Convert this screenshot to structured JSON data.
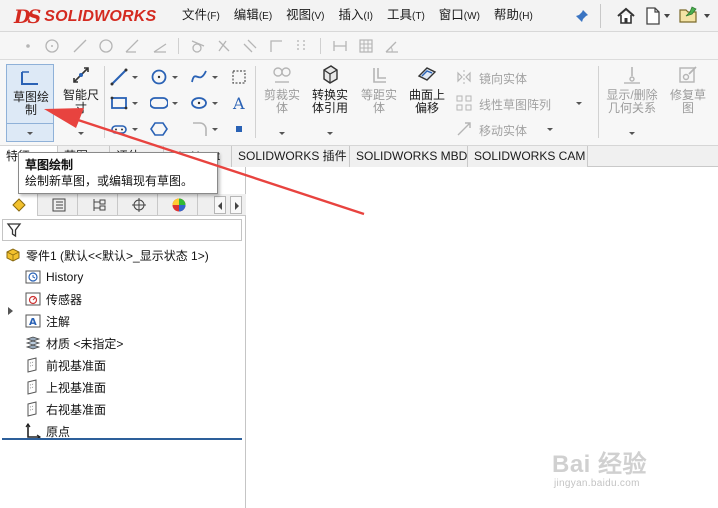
{
  "app": {
    "logo_ds": "DS",
    "logo_text": "SOLIDWORKS"
  },
  "menu": [
    {
      "label": "文件",
      "mnemonic": "(F)"
    },
    {
      "label": "编辑",
      "mnemonic": "(E)"
    },
    {
      "label": "视图",
      "mnemonic": "(V)"
    },
    {
      "label": "插入",
      "mnemonic": "(I)"
    },
    {
      "label": "工具",
      "mnemonic": "(T)"
    },
    {
      "label": "窗口",
      "mnemonic": "(W)"
    },
    {
      "label": "帮助",
      "mnemonic": "(H)"
    }
  ],
  "commands": {
    "sketch": "草图绘制",
    "smart_dimension": "智能尺寸",
    "trim_entities": "剪裁实体",
    "convert_entities": "转换实体引用",
    "offset_entities": "等距实体",
    "offset_on_surface": "曲面上偏移",
    "mirror_entities": "镜向实体",
    "linear_pattern": "线性草图阵列",
    "move_entities": "移动实体",
    "display_delete_relations": "显示/删除几何关系",
    "repair_sketch": "修复草图"
  },
  "tabs": [
    "特征",
    "草图",
    "评估",
    "DimXpert",
    "SOLIDWORKS 插件",
    "SOLIDWORKS MBD",
    "SOLIDWORKS CAM"
  ],
  "tooltip": {
    "title": "草图绘制",
    "description": "绘制新草图，或编辑现有草图。"
  },
  "tree": {
    "part": "零件1 (默认<<默认>_显示状态 1>)",
    "items": [
      "History",
      "传感器",
      "注解",
      "材质 <未指定>",
      "前视基准面",
      "上视基准面",
      "右视基准面",
      "原点"
    ]
  },
  "watermark": {
    "brand": "Bai 经验",
    "url": "jingyan.baidu.com"
  },
  "colors": {
    "brand_red": "#d42a20",
    "annotation_arrow": "#e8433f",
    "selection_blue": "#dde9f6",
    "tree_separator": "#2d5f9a"
  }
}
